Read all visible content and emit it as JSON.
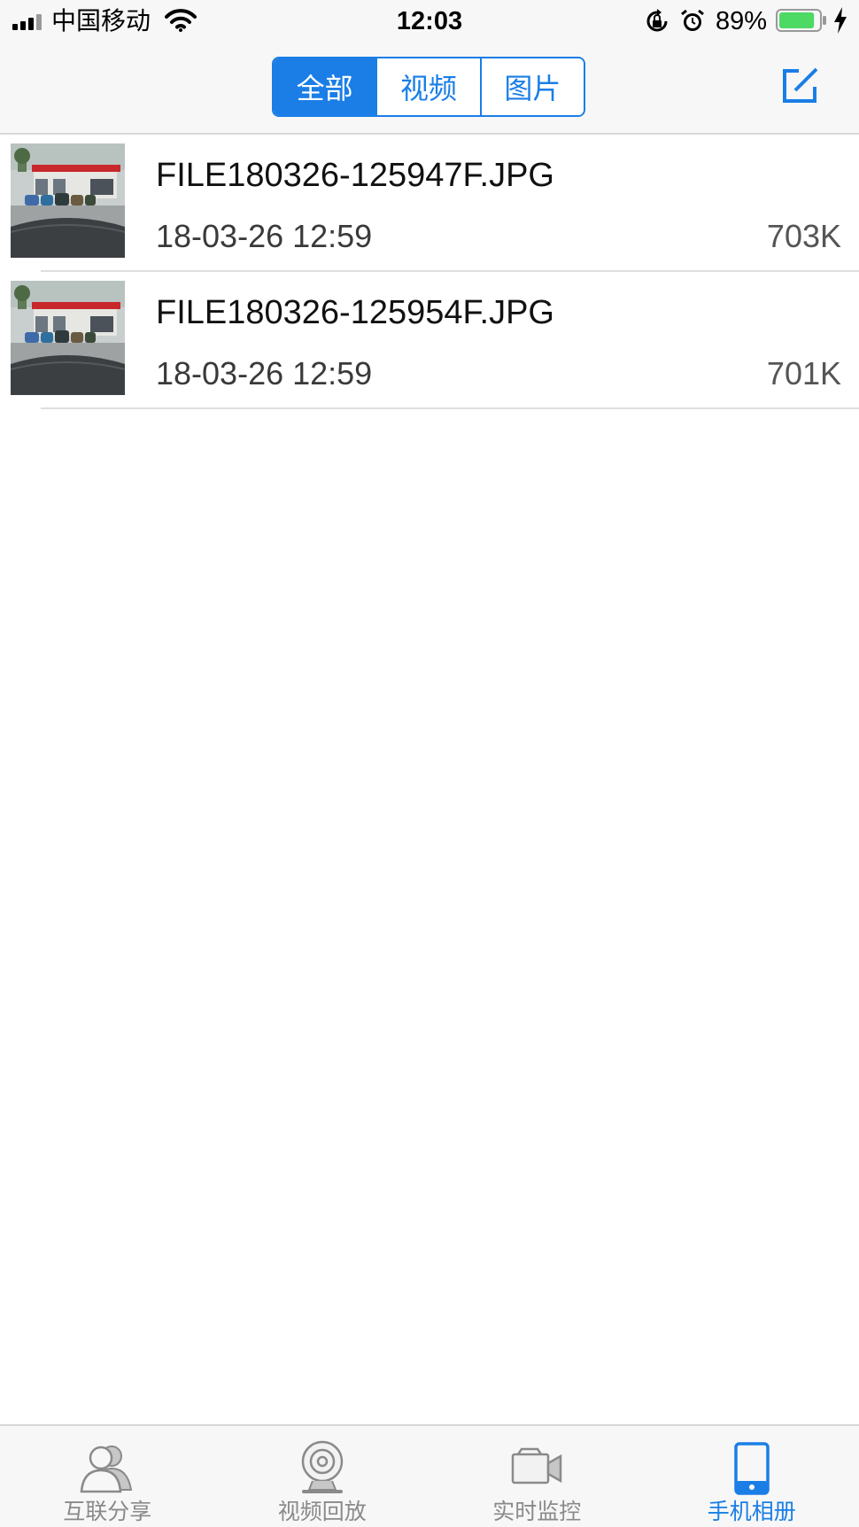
{
  "status_bar": {
    "carrier": "中国移动",
    "time": "12:03",
    "battery_percent": "89%",
    "battery_level": 0.89,
    "icons": [
      "signal-icon",
      "wifi-icon",
      "rotation-lock-icon",
      "alarm-icon",
      "battery-icon",
      "charging-icon"
    ]
  },
  "nav": {
    "segments": [
      {
        "label": "全部",
        "active": true
      },
      {
        "label": "视频",
        "active": false
      },
      {
        "label": "图片",
        "active": false
      }
    ],
    "edit_icon": "edit-icon"
  },
  "files": [
    {
      "name": "FILE180326-125947F.JPG",
      "date": "18-03-26 12:59",
      "size": "703K"
    },
    {
      "name": "FILE180326-125954F.JPG",
      "date": "18-03-26 12:59",
      "size": "701K"
    }
  ],
  "tabs": [
    {
      "label": "互联分享",
      "icon": "users-icon",
      "active": false
    },
    {
      "label": "视频回放",
      "icon": "webcam-icon",
      "active": false
    },
    {
      "label": "实时监控",
      "icon": "video-camera-icon",
      "active": false
    },
    {
      "label": "手机相册",
      "icon": "phone-icon",
      "active": true
    }
  ],
  "colors": {
    "accent": "#1a7ee6",
    "tab_inactive": "#8a8a8a",
    "battery_fill": "#4cd964"
  }
}
